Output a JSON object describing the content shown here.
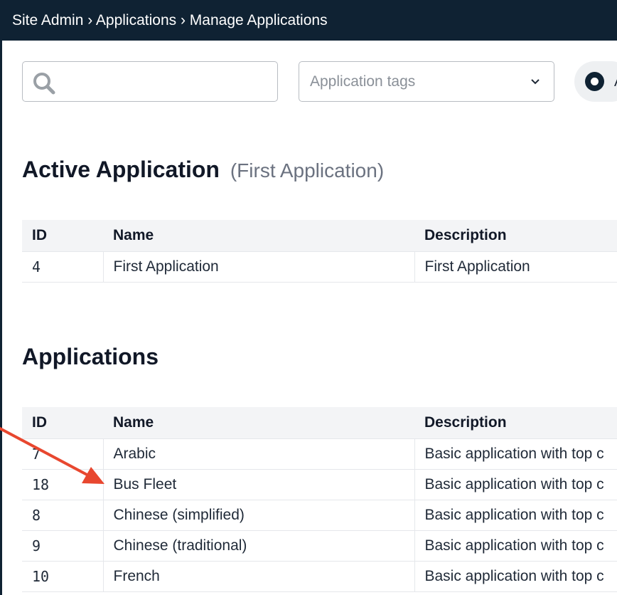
{
  "breadcrumb": "Site Admin › Applications › Manage Applications",
  "search": {
    "value": ""
  },
  "tags_select": {
    "placeholder": "Application tags"
  },
  "toggle": {
    "label": "A"
  },
  "active_section": {
    "title": "Active Application",
    "subtitle": "(First Application)",
    "columns": [
      "ID",
      "Name",
      "Description"
    ],
    "rows": [
      {
        "id": "4",
        "name": "First Application",
        "description": "First Application"
      }
    ]
  },
  "apps_section": {
    "title": "Applications",
    "columns": [
      "ID",
      "Name",
      "Description"
    ],
    "rows": [
      {
        "id": "7",
        "name": "Arabic",
        "description": "Basic application with top c"
      },
      {
        "id": "18",
        "name": "Bus Fleet",
        "description": "Basic application with top c"
      },
      {
        "id": "8",
        "name": "Chinese (simplified)",
        "description": "Basic application with top c"
      },
      {
        "id": "9",
        "name": "Chinese (traditional)",
        "description": "Basic application with top c"
      },
      {
        "id": "10",
        "name": "French",
        "description": "Basic application with top c"
      }
    ]
  },
  "colors": {
    "header_bg": "#0f2233",
    "annotation_arrow": "#e8472f"
  },
  "icons": {
    "search": "search-icon",
    "dropdown": "chevron-down-icon",
    "radio": "radio-selected-icon",
    "annotation": "red-arrow-icon"
  }
}
